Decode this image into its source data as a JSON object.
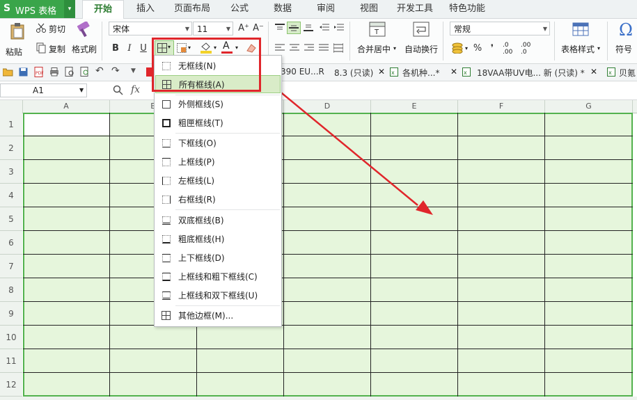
{
  "app": {
    "logo": "S",
    "title": "WPS 表格"
  },
  "menubar": {
    "tabs": [
      "开始",
      "插入",
      "页面布局",
      "公式",
      "数据",
      "审阅",
      "视图",
      "开发工具",
      "特色功能"
    ],
    "active": "开始"
  },
  "ribbon": {
    "paste": "粘贴",
    "cut": "剪切",
    "copy": "复制",
    "format_painter": "格式刷",
    "font_name": "宋体",
    "font_size": "11",
    "bold": "B",
    "italic": "I",
    "underline": "U",
    "font_color_letter": "A",
    "merge_center": "合并居中",
    "wrap_text": "自动换行",
    "number_format": "常规",
    "percent": "%",
    "comma": "❜",
    "inc_decimal": ".0 .00",
    "table_style": "表格样式",
    "symbol": "符号",
    "grow_font": "A⁺",
    "shrink_font": "A⁻"
  },
  "quick_toolbar": {
    "doc_tabs": [
      "390 EU...R",
      "8.3 (只读)",
      "各机种...*",
      "18VAA带UV电... 新 (只读) *",
      "贝氪"
    ]
  },
  "formula_bar": {
    "name_box": "A1",
    "fx": "fx",
    "zoom_icon": "search-icon"
  },
  "sheet": {
    "columns": [
      "A",
      "B",
      "C",
      "D",
      "E",
      "F",
      "G"
    ],
    "rows": [
      "1",
      "2",
      "3",
      "4",
      "5",
      "6",
      "7",
      "8",
      "9",
      "10",
      "11",
      "12"
    ]
  },
  "border_menu": {
    "items": [
      "无框线(N)",
      "所有框线(A)",
      "外侧框线(S)",
      "粗匣框线(T)",
      "下框线(O)",
      "上框线(P)",
      "左框线(L)",
      "右框线(R)",
      "双底框线(B)",
      "粗底框线(H)",
      "上下框线(D)",
      "上框线和粗下框线(C)",
      "上框线和双下框线(U)",
      "其他边框(M)..."
    ],
    "highlighted_index": 1
  },
  "colors": {
    "accent_green": "#3aa54a",
    "sheet_fill": "#e6f6dc",
    "annotation_red": "#e0262b"
  }
}
